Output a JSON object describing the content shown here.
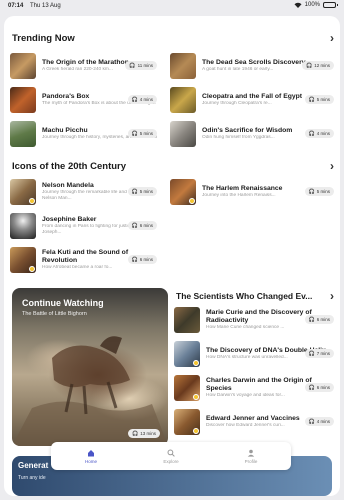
{
  "status_bar": {
    "time": "07:14",
    "date": "Thu 13 Aug",
    "battery": "100%",
    "battery_level": 1.0
  },
  "trending": {
    "title": "Trending Now",
    "items": [
      {
        "title": "The Origin of the Marathon",
        "subtitle": "A Greek herald ran 220-240 km...",
        "duration": "11 mins"
      },
      {
        "title": "The Dead Sea Scrolls Discovery",
        "subtitle": "A goat hunt in late 1946 or early...",
        "duration": "12 mins"
      },
      {
        "title": "Pandora's Box",
        "subtitle": "The myth of Pandora's Box is about the unleashing of human ...",
        "duration": "4 mins"
      },
      {
        "title": "Cleopatra and the Fall of Egypt",
        "subtitle": "Journey through Cleopatra's re...",
        "duration": "5 mins"
      },
      {
        "title": "Machu Picchu",
        "subtitle": "Journey through the history, mysteries, and wonders of Ma...",
        "duration": "5 mins"
      },
      {
        "title": "Odin's Sacrifice for Wisdom",
        "subtitle": "Odin hung himself from Yggdras...",
        "duration": "4 mins"
      }
    ]
  },
  "icons": {
    "title": "Icons of the 20th Century",
    "items": [
      {
        "title": "Nelson Mandela",
        "subtitle": "Journey through the remarkable life and impact of Nelson Man...",
        "duration": "5 mins"
      },
      {
        "title": "The Harlem Renaissance",
        "subtitle": "Journey into the Harlem Renaiss...",
        "duration": "5 mins"
      },
      {
        "title": "Josephine Baker",
        "subtitle": "From dancing in Paris to fighting for justice, discover Joseph...",
        "duration": "6 mins"
      },
      {
        "title": "Fela Kuti and the Sound of Revolution",
        "subtitle": "How Afrobeat became a roar fo...",
        "duration": "6 mins"
      }
    ]
  },
  "continue_watching": {
    "title": "Continue Watching",
    "subtitle": "The Battle of Little Bighorn",
    "duration": "13 mins"
  },
  "scientists": {
    "title": "The Scientists Who Changed Ev...",
    "items": [
      {
        "title": "Marie Curie and the Discovery of Radioactivity",
        "subtitle": "How Marie Curie changed science ...",
        "duration": "6 mins"
      },
      {
        "title": "The Discovery of DNA's Double Helix",
        "subtitle": "How DNA's structure was unravelled...",
        "duration": "7 mins"
      },
      {
        "title": "Charles Darwin and the Origin of Species",
        "subtitle": "How Darwin's voyage and ideas for...",
        "duration": "6 mins"
      },
      {
        "title": "Edward Jenner and Vaccines",
        "subtitle": "Discover how Edward Jenner's curi...",
        "duration": "4 mins"
      }
    ]
  },
  "generate": {
    "title": "Generat",
    "subtitle": "Turn any ide"
  },
  "tabs": [
    {
      "label": "Home",
      "icon": "home-icon",
      "active": true
    },
    {
      "label": "Explore",
      "icon": "search-icon",
      "active": false
    },
    {
      "label": "Profile",
      "icon": "person-icon",
      "active": false
    }
  ],
  "colors": {
    "accent": "#4a55c7",
    "badge_bg": "#ececec",
    "star": "#f4c430"
  }
}
